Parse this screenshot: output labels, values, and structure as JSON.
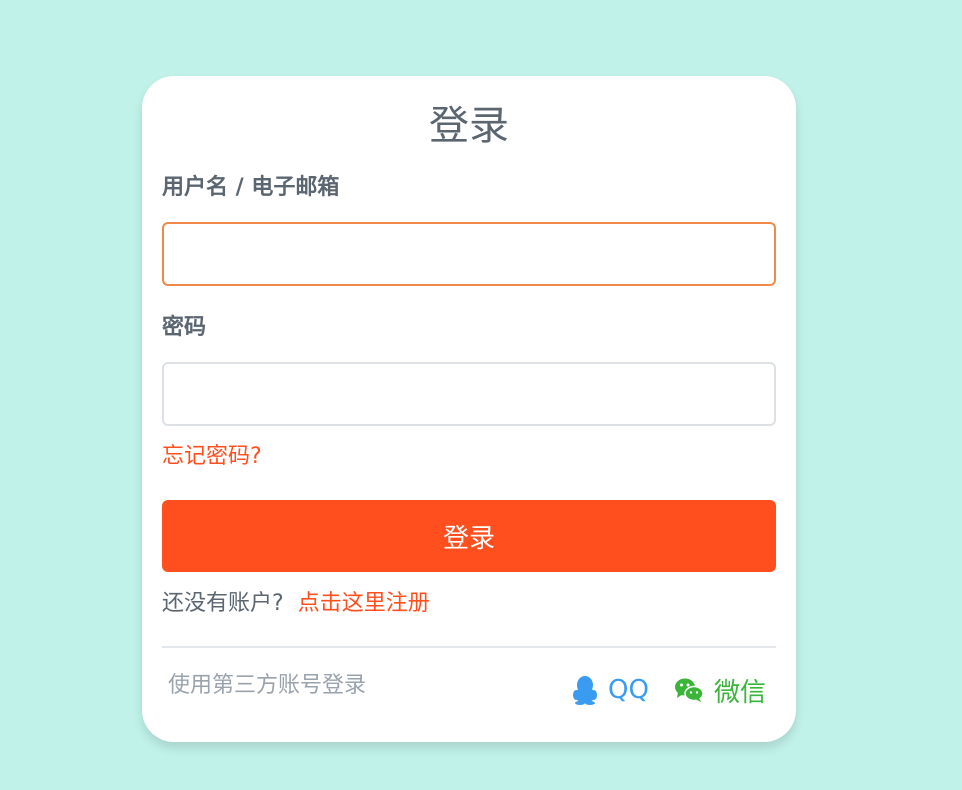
{
  "login": {
    "title": "登录",
    "username_label": "用户名 / 电子邮箱",
    "username_value": "",
    "password_label": "密码",
    "password_value": "",
    "forgot_password": "忘记密码?",
    "submit_label": "登录",
    "no_account_text": "还没有账户?",
    "register_link": "点击这里注册",
    "third_party_label": "使用第三方账号登录",
    "qq_label": "QQ",
    "wechat_label": "微信"
  },
  "colors": {
    "background": "#c0f2e9",
    "accent": "#ff4f1f",
    "qq": "#3a9cf0",
    "wechat": "#3ab53a"
  },
  "icons": {
    "qq": "qq-penguin-icon",
    "wechat": "wechat-chat-bubbles-icon"
  }
}
